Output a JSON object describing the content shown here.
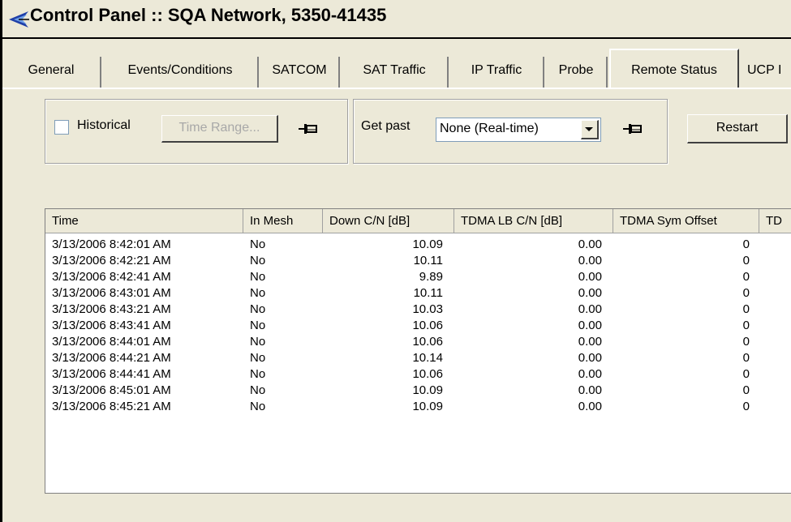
{
  "window": {
    "title": "Control Panel :: SQA Network, 5350-41435"
  },
  "tabs": [
    {
      "label": "General"
    },
    {
      "label": "Events/Conditions"
    },
    {
      "label": "SATCOM"
    },
    {
      "label": "SAT Traffic"
    },
    {
      "label": "IP Traffic"
    },
    {
      "label": "Probe"
    },
    {
      "label": "Remote Status",
      "active": true
    },
    {
      "label": "UCP I"
    }
  ],
  "toolbar": {
    "historical_label": "Historical",
    "historical_checked": false,
    "time_range_label": "Time Range...",
    "get_past_label": "Get past",
    "get_past_value": "None (Real-time)",
    "restart_label": "Restart"
  },
  "table": {
    "columns": [
      "Time",
      "In Mesh",
      "Down C/N [dB]",
      "TDMA LB C/N [dB]",
      "TDMA Sym Offset",
      "TD"
    ],
    "rows": [
      [
        "3/13/2006  8:42:01 AM",
        "No",
        "10.09",
        "0.00",
        "0"
      ],
      [
        "3/13/2006  8:42:21 AM",
        "No",
        "10.11",
        "0.00",
        "0"
      ],
      [
        "3/13/2006  8:42:41 AM",
        "No",
        "9.89",
        "0.00",
        "0"
      ],
      [
        "3/13/2006  8:43:01 AM",
        "No",
        "10.11",
        "0.00",
        "0"
      ],
      [
        "3/13/2006  8:43:21 AM",
        "No",
        "10.03",
        "0.00",
        "0"
      ],
      [
        "3/13/2006  8:43:41 AM",
        "No",
        "10.06",
        "0.00",
        "0"
      ],
      [
        "3/13/2006  8:44:01 AM",
        "No",
        "10.06",
        "0.00",
        "0"
      ],
      [
        "3/13/2006  8:44:21 AM",
        "No",
        "10.14",
        "0.00",
        "0"
      ],
      [
        "3/13/2006  8:44:41 AM",
        "No",
        "10.06",
        "0.00",
        "0"
      ],
      [
        "3/13/2006  8:45:01 AM",
        "No",
        "10.09",
        "0.00",
        "0"
      ],
      [
        "3/13/2006  8:45:21 AM",
        "No",
        "10.09",
        "0.00",
        "0"
      ]
    ]
  },
  "icons": {
    "title": "satellite-dish-icon",
    "pin": "pushpin-icon",
    "dropdown": "chevron-down-icon"
  },
  "colors": {
    "window_bg": "#ece9d8",
    "title_icon_blue": "#1f3fa8",
    "input_border": "#7f9db9"
  }
}
